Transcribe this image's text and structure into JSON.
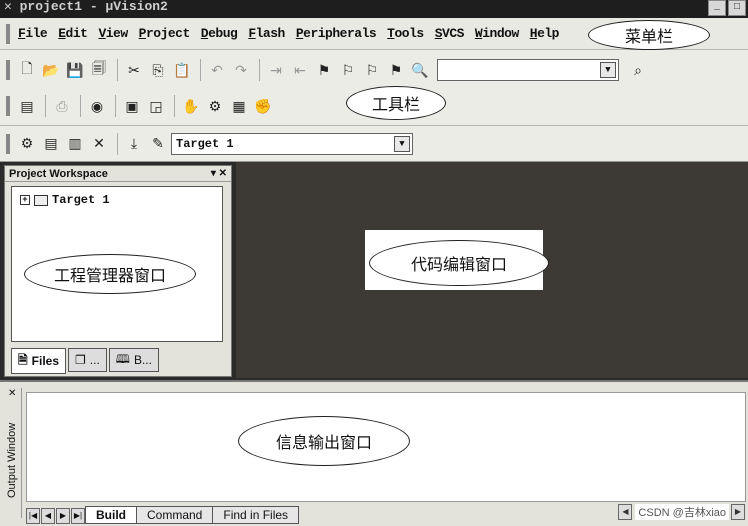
{
  "window": {
    "title": "✕ project1 - µVision2"
  },
  "menu": [
    "File",
    "Edit",
    "View",
    "Project",
    "Debug",
    "Flash",
    "Peripherals",
    "Tools",
    "SVCS",
    "Window",
    "Help"
  ],
  "annotations": {
    "menubar": "菜单栏",
    "toolbar": "工具栏",
    "project_manager": "工程管理器窗口",
    "code_editor": "代码编辑窗口",
    "output": "信息输出窗口"
  },
  "toolbar": {
    "target_select": "Target 1",
    "find_combo": ""
  },
  "workspace": {
    "title": "Project Workspace",
    "controls": "▾ ✕",
    "tree_root": "Target 1",
    "tabs": [
      "Files",
      "...",
      "B..."
    ]
  },
  "output": {
    "title": "Output Window",
    "tabs": [
      "Build",
      "Command",
      "Find in Files"
    ]
  },
  "watermark": "CSDN @吉林xiao"
}
